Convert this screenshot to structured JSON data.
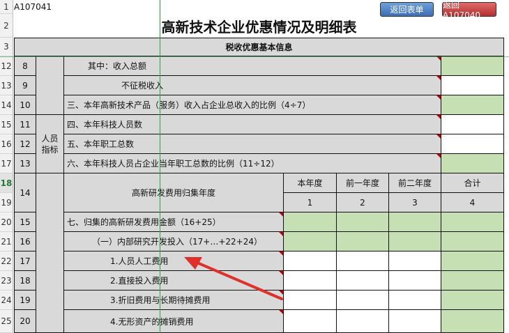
{
  "sheet": {
    "cell_ref": "A107041",
    "title": "高新技术企业优惠情况及明细表",
    "section_header": "税收优惠基本信息"
  },
  "buttons": {
    "return_table": "返回表单",
    "return_a107040": "返回A107040"
  },
  "row_numbers": [
    "1",
    "2",
    "3",
    "12",
    "13",
    "14",
    "15",
    "16",
    "17",
    "18",
    "19",
    "20",
    "21",
    "22",
    "23",
    "24",
    "25"
  ],
  "group_label": "人员\n指标",
  "rows": [
    {
      "num": "8",
      "label": "其中：收入总额"
    },
    {
      "num": "9",
      "label": "不征税收入"
    },
    {
      "num": "10",
      "label": "三、本年高新技术产品（服务）收入占企业总收入的比例（4÷7）"
    },
    {
      "num": "11",
      "label": "四、本年科技人员数"
    },
    {
      "num": "12",
      "label": "五、本年职工总数"
    },
    {
      "num": "13",
      "label": "六、本年科技人员占企业当年职工总数的比例（11÷12）"
    },
    {
      "num": "14",
      "label": "高新研发费用归集年度"
    },
    {
      "num": "15",
      "label": "七、归集的高新研发费用金额（16+25）"
    },
    {
      "num": "16",
      "label": "（一）内部研究开发投入（17+…+22+24）"
    },
    {
      "num": "17",
      "label": "1.人员人工费用"
    },
    {
      "num": "18",
      "label": "2.直接投入费用"
    },
    {
      "num": "19",
      "label": "3.折旧费用与长期待摊费用"
    },
    {
      "num": "20",
      "label": "4.无形资产的摊销费用"
    }
  ],
  "year_headers": [
    "本年度",
    "前一年度",
    "前二年度",
    "合计"
  ],
  "year_cols": [
    "1",
    "2",
    "3",
    "4"
  ],
  "colors": {
    "green_input": "#c6e0b4",
    "gray_label": "#d9d9d9",
    "arrow": "#e0302a"
  }
}
